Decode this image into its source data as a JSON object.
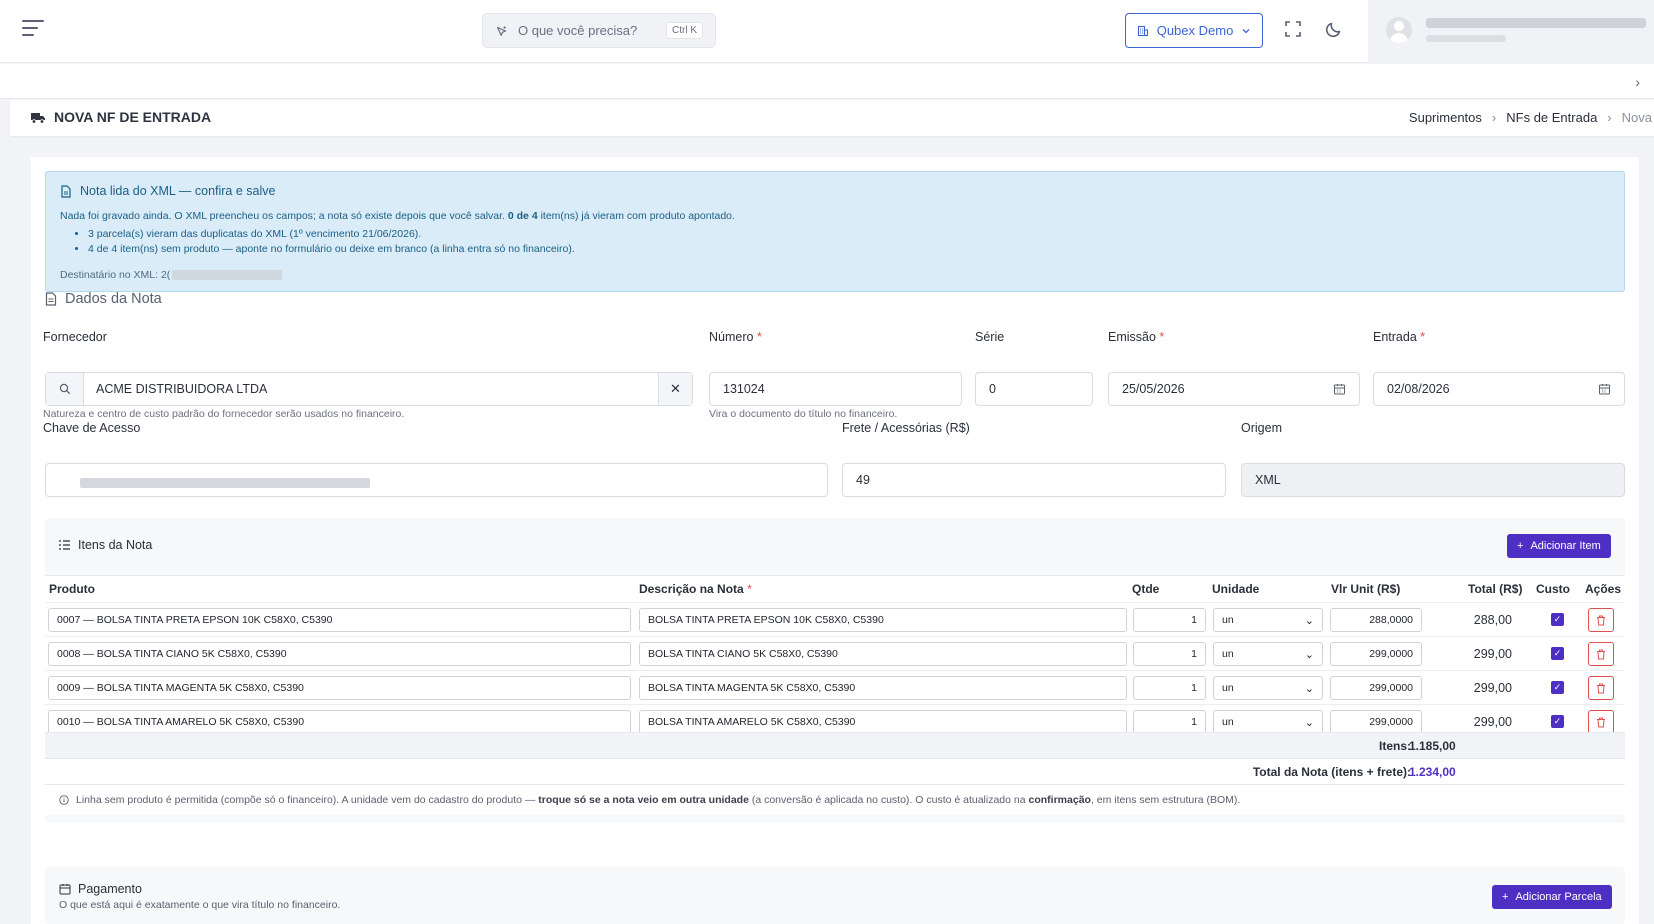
{
  "topbar": {
    "search_placeholder": "O que você precisa?",
    "search_shortcut": "Ctrl K",
    "company_button": "Qubex Demo"
  },
  "page": {
    "title": "NOVA NF DE ENTRADA",
    "breadcrumbs": [
      "Suprimentos",
      "NFs de Entrada",
      "Nova"
    ]
  },
  "alert": {
    "title": "Nota lida do XML — confira e salve",
    "line1_pre": "Nada foi gravado ainda. O XML preencheu os campos; a nota só existe depois que você salvar. ",
    "line1_bold": "0 de 4",
    "line1_post": " item(ns) já vieram com produto apontado.",
    "bullets": [
      "3 parcela(s) vieram das duplicatas do XML (1º vencimento 21/06/2026).",
      "4 de 4 item(ns) sem produto — aponte no formulário ou deixe em branco (a linha entra só no financeiro)."
    ],
    "destinatario_label": "Destinatário no XML: 2("
  },
  "dados": {
    "section_title": "Dados da Nota",
    "fornecedor_label": "Fornecedor",
    "fornecedor_value": "ACME DISTRIBUIDORA LTDA",
    "fornecedor_hint": "Natureza e centro de custo padrão do fornecedor serão usados no financeiro.",
    "numero_label": "Número",
    "numero_value": "131024",
    "numero_hint": "Vira o documento do título no financeiro.",
    "serie_label": "Série",
    "serie_value": "0",
    "emissao_label": "Emissão",
    "emissao_value": "25/05/2026",
    "entrada_label": "Entrada",
    "entrada_value": "02/08/2026",
    "chave_label": "Chave de Acesso",
    "frete_label": "Frete / Acessórias (R$)",
    "frete_value": "49",
    "origem_label": "Origem",
    "origem_value": "XML"
  },
  "itens": {
    "title": "Itens da Nota",
    "add_button": "Adicionar Item",
    "columns": {
      "produto": "Produto",
      "descricao": "Descrição na Nota",
      "qtde": "Qtde",
      "unidade": "Unidade",
      "vlr_unit": "Vlr Unit (R$)",
      "total": "Total (R$)",
      "custo": "Custo",
      "acoes": "Ações"
    },
    "rows": [
      {
        "produto": "0007 — BOLSA TINTA PRETA EPSON 10K C58X0, C5390",
        "descricao": "BOLSA TINTA PRETA EPSON 10K C58X0, C5390",
        "qtde": "1",
        "unidade": "un",
        "vlr_unit": "288,0000",
        "total": "288,00"
      },
      {
        "produto": "0008 — BOLSA TINTA CIANO 5K C58X0, C5390",
        "descricao": "BOLSA TINTA CIANO 5K C58X0, C5390",
        "qtde": "1",
        "unidade": "un",
        "vlr_unit": "299,0000",
        "total": "299,00"
      },
      {
        "produto": "0009 — BOLSA TINTA MAGENTA 5K C58X0, C5390",
        "descricao": "BOLSA TINTA MAGENTA 5K C58X0, C5390",
        "qtde": "1",
        "unidade": "un",
        "vlr_unit": "299,0000",
        "total": "299,00"
      },
      {
        "produto": "0010 — BOLSA TINTA AMARELO 5K C58X0, C5390",
        "descricao": "BOLSA TINTA AMARELO 5K C58X0, C5390",
        "qtde": "1",
        "unidade": "un",
        "vlr_unit": "299,0000",
        "total": "299,00"
      }
    ],
    "itens_label": "Itens:",
    "itens_total": "1.185,00",
    "nota_label": "Total da Nota (itens + frete):",
    "nota_total": "1.234,00",
    "note_pre": "Linha sem produto é permitida (compõe só o financeiro). A unidade vem do cadastro do produto — ",
    "note_bold1": "troque só se a nota veio em outra unidade",
    "note_mid": " (a conversão é aplicada no custo). O custo é atualizado na ",
    "note_bold2": "confirmação",
    "note_post": ", em itens sem estrutura (BOM)."
  },
  "pagamento": {
    "title": "Pagamento",
    "subtitle": "O que está aqui é exatamente o que vira título no financeiro.",
    "add_button": "Adicionar Parcela"
  },
  "colors": {
    "primary": "#4e2fc4",
    "alert_bg": "#d9ecf8",
    "alert_text": "#1b5f87",
    "danger": "#e15050",
    "link": "#3a64d8"
  }
}
